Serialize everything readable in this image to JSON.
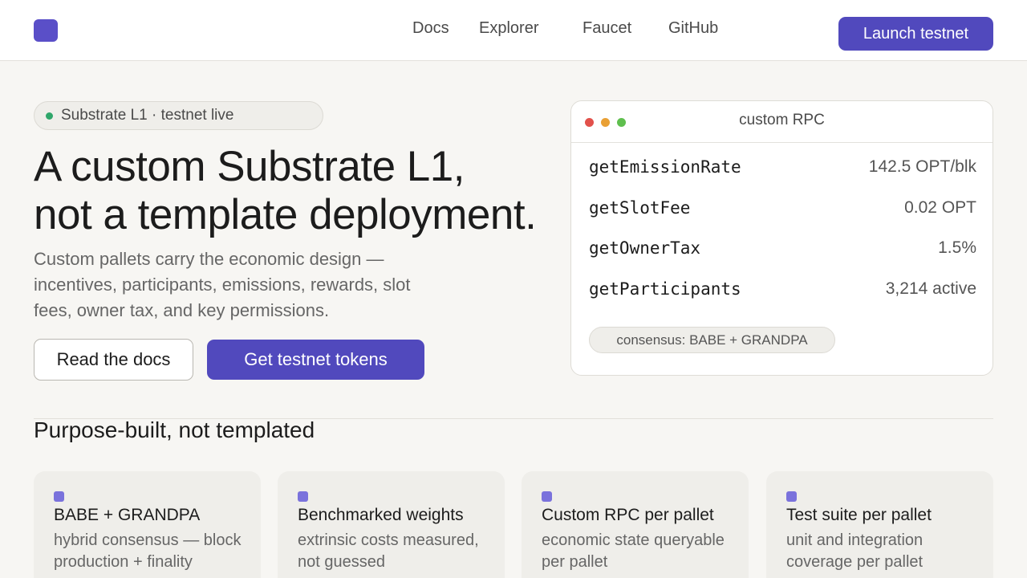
{
  "nav": {
    "links": [
      "Docs",
      "Explorer",
      "Faucet",
      "GitHub"
    ],
    "cta": "Launch testnet"
  },
  "hero": {
    "badge": "Substrate L1 · testnet live",
    "headline_line1": "A custom Substrate L1,",
    "headline_line2": "not a template deployment.",
    "subtext": "Custom pallets carry the economic design — incentives, participants, emissions, rewards, slot fees, owner tax, and key permissions.",
    "btn_docs": "Read the docs",
    "btn_tokens": "Get testnet tokens"
  },
  "rpc": {
    "title": "custom RPC",
    "rows": [
      {
        "method": "getEmissionRate",
        "value": "142.5 OPT/blk"
      },
      {
        "method": "getSlotFee",
        "value": "0.02 OPT"
      },
      {
        "method": "getOwnerTax",
        "value": "1.5%"
      },
      {
        "method": "getParticipants",
        "value": "3,214 active"
      }
    ],
    "consensus": "consensus: BABE + GRANDPA",
    "dot_colors": [
      "#e2514b",
      "#e9a035",
      "#5fbf4e"
    ]
  },
  "features": {
    "title": "Purpose-built, not templated",
    "items": [
      {
        "title": "BABE + GRANDPA",
        "desc": "hybrid consensus — block production + finality"
      },
      {
        "title": "Benchmarked weights",
        "desc": "extrinsic costs measured, not guessed"
      },
      {
        "title": "Custom RPC per pallet",
        "desc": "economic state queryable per pallet"
      },
      {
        "title": "Test suite per pallet",
        "desc": "unit and integration coverage per pallet"
      }
    ]
  },
  "colors": {
    "accent": "#5149bd",
    "background": "#f7f6f3",
    "live": "#2fa66a"
  }
}
